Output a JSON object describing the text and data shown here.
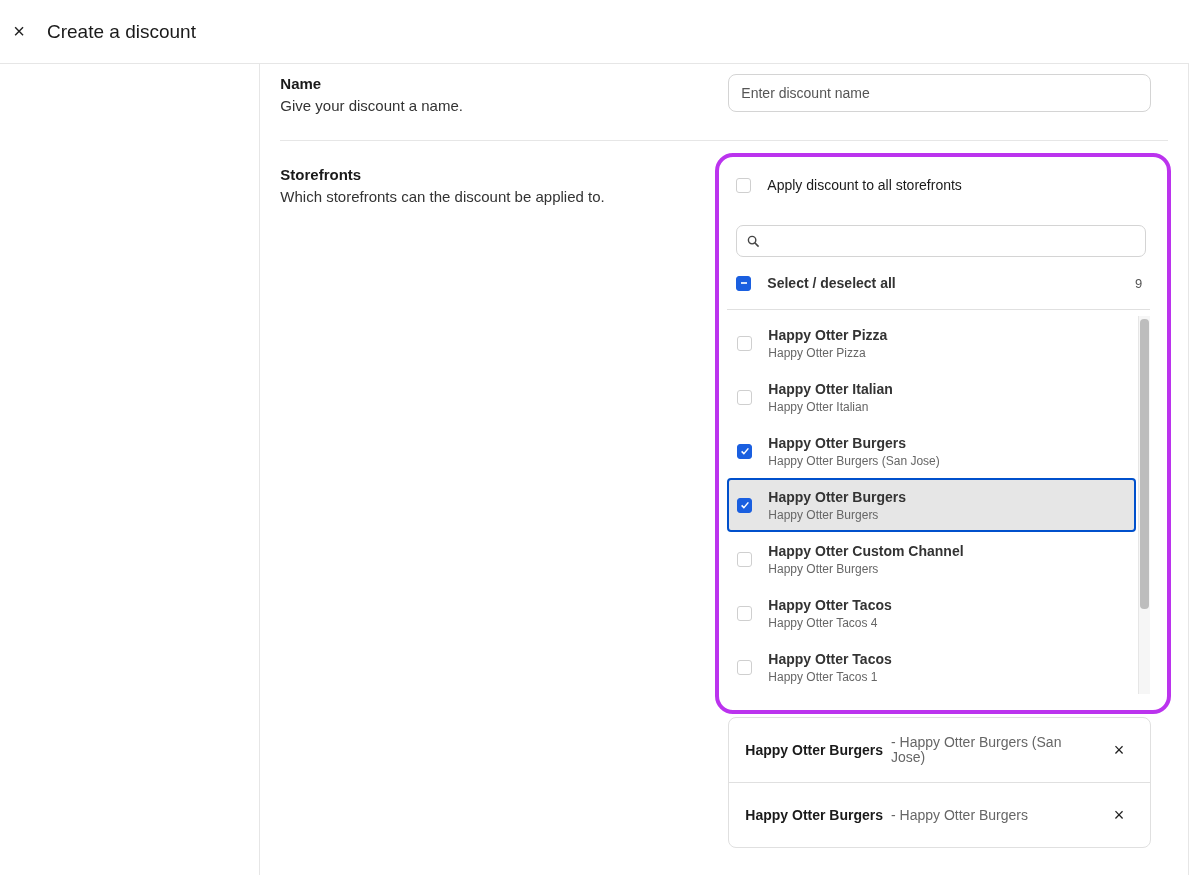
{
  "header": {
    "close": "×",
    "title": "Create a discount"
  },
  "name_section": {
    "title": "Name",
    "description": "Give your discount a name.",
    "placeholder": "Enter discount name"
  },
  "storefronts_section": {
    "title": "Storefronts",
    "description": "Which storefronts can the discount be applied to.",
    "apply_all": {
      "label": "Apply discount to all storefronts",
      "checked": false
    },
    "select_all": {
      "label": "Select / deselect all",
      "indeterminate": true,
      "count": "9"
    },
    "items": [
      {
        "name": "Happy Otter Pizza",
        "sub": "Happy Otter Pizza",
        "checked": false,
        "focused": false
      },
      {
        "name": "Happy Otter Italian",
        "sub": "Happy Otter Italian",
        "checked": false,
        "focused": false
      },
      {
        "name": "Happy Otter Burgers",
        "sub": "Happy Otter Burgers (San Jose)",
        "checked": true,
        "focused": false
      },
      {
        "name": "Happy Otter Burgers",
        "sub": "Happy Otter Burgers",
        "checked": true,
        "focused": true
      },
      {
        "name": "Happy Otter Custom Channel",
        "sub": "Happy Otter Burgers",
        "checked": false,
        "focused": false
      },
      {
        "name": "Happy Otter Tacos",
        "sub": "Happy Otter Tacos 4",
        "checked": false,
        "focused": false
      },
      {
        "name": "Happy Otter Tacos",
        "sub": "Happy Otter Tacos 1",
        "checked": false,
        "focused": false
      }
    ],
    "selected": [
      {
        "name": "Happy Otter Burgers",
        "detail": "- Happy Otter Burgers (San Jose)",
        "remove": "×"
      },
      {
        "name": "Happy Otter Burgers",
        "detail": "- Happy Otter Burgers",
        "remove": "×"
      }
    ]
  }
}
